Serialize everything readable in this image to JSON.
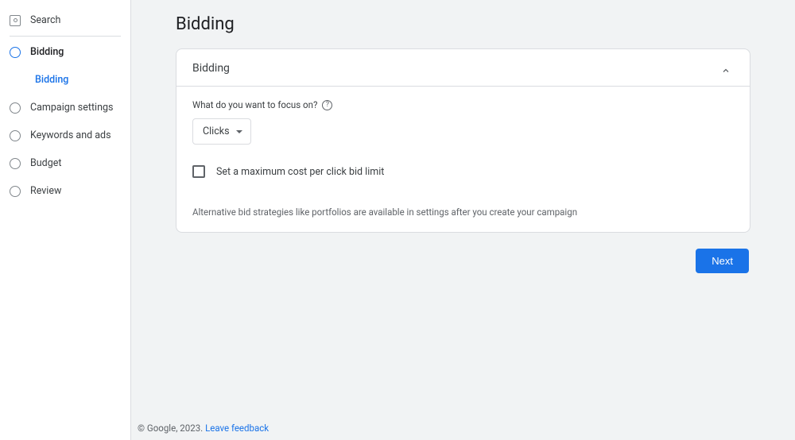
{
  "sidebar": {
    "search_label": "Search",
    "items": [
      {
        "label": "Bidding",
        "active": true
      },
      {
        "label": "Campaign settings"
      },
      {
        "label": "Keywords and ads"
      },
      {
        "label": "Budget"
      },
      {
        "label": "Review"
      }
    ],
    "subitems": [
      {
        "label": "Bidding"
      }
    ]
  },
  "page": {
    "title": "Bidding"
  },
  "card": {
    "header_title": "Bidding",
    "focus_label": "What do you want to focus on?",
    "dropdown_value": "Clicks",
    "checkbox_label": "Set a maximum cost per click bid limit",
    "info_text": "Alternative bid strategies like portfolios are available in settings after you create your campaign"
  },
  "actions": {
    "next": "Next"
  },
  "footer": {
    "copyright": "© Google, 2023.",
    "feedback": "Leave feedback"
  }
}
